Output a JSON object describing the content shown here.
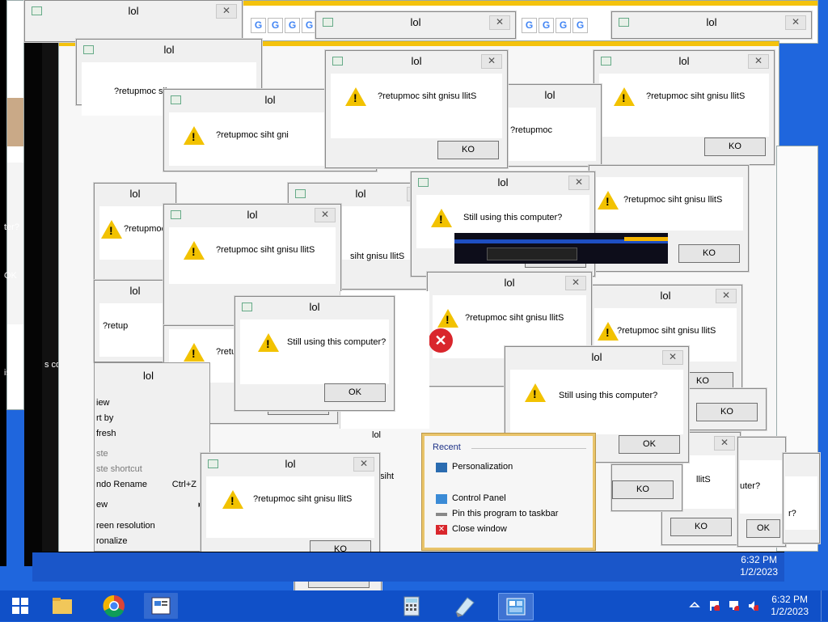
{
  "window_title": "lol",
  "messages": {
    "reversed": "?retupmoc siht gnisu llitS",
    "normal": "Still using this computer?"
  },
  "buttons": {
    "ok": "OK",
    "ko": "KO"
  },
  "fragments": {
    "reversed_partial_1": "?retupmoc siht gni",
    "reversed_partial_2": "?retupmoc siht gnisu",
    "reversed_partial_3": "?retupmoc siht gnisu llit",
    "reversed_partial_4": "?retu",
    "reversed_partial_5": "siht gnisu llitS",
    "reversed_partial_6": "?retupmoc",
    "reversed_partial_7": "?retup",
    "reversed_partial_8": "?retupmoc sih",
    "reversed_partial_9": "siht",
    "reversed_partial_10": "llitS",
    "normal_partial_1": "ter?",
    "normal_partial_2": "uter?",
    "normal_partial_3": "s co",
    "normal_partial_4": "is co",
    "normal_partial_5": "r?",
    "ok_partial": "OK",
    "ok_partial_2": "OK",
    "ko_partial": "KO"
  },
  "context_menu": [
    {
      "label": "View",
      "shortcut": "",
      "arrow": true,
      "dim": false
    },
    {
      "label": "Sort by",
      "shortcut": "",
      "arrow": false,
      "dim": false
    },
    {
      "label": "Refresh",
      "shortcut": "",
      "arrow": false,
      "dim": false
    },
    {
      "label": "Paste",
      "shortcut": "",
      "arrow": false,
      "dim": true
    },
    {
      "label": "Paste shortcut",
      "shortcut": "",
      "arrow": false,
      "dim": true
    },
    {
      "label": "Undo Rename",
      "shortcut": "Ctrl+Z",
      "arrow": false,
      "dim": false
    },
    {
      "label": "New",
      "shortcut": "",
      "arrow": true,
      "dim": false
    },
    {
      "label": "Screen resolution",
      "shortcut": "",
      "arrow": false,
      "dim": false
    },
    {
      "label": "Personalize",
      "shortcut": "",
      "arrow": false,
      "dim": false
    }
  ],
  "context_menu_visible": {
    "view": "iew",
    "sort": "rt by",
    "refresh": "fresh",
    "paste": "ste",
    "paste_shortcut": "ste shortcut",
    "undo": "ndo Rename",
    "undo_key": "Ctrl+Z",
    "new": "ew",
    "screen": "reen resolution",
    "personalize": "ronalize"
  },
  "jump_list": {
    "header": "Recent",
    "recent": [
      "Personalization"
    ],
    "tasks": [
      "Control Panel",
      "Pin this program to taskbar",
      "Close window"
    ]
  },
  "clock": {
    "time": "6:32 PM",
    "date": "1/2/2023",
    "ghost_time": "6:32 PM",
    "ghost_date": "1/2/2023"
  },
  "tabs_google": "G",
  "colors": {
    "taskbar": "#1050c8",
    "desktop": "#1f66dd",
    "warning": "#f2c200",
    "error": "#d9262c",
    "jumplist_border": "#e9c46a"
  },
  "icons": [
    "start-icon",
    "file-explorer-icon",
    "chrome-icon",
    "document-icon",
    "calculator-icon",
    "paint-icon",
    "control-panel-icon",
    "flag-icon",
    "network-icon",
    "volume-muted-icon"
  ]
}
